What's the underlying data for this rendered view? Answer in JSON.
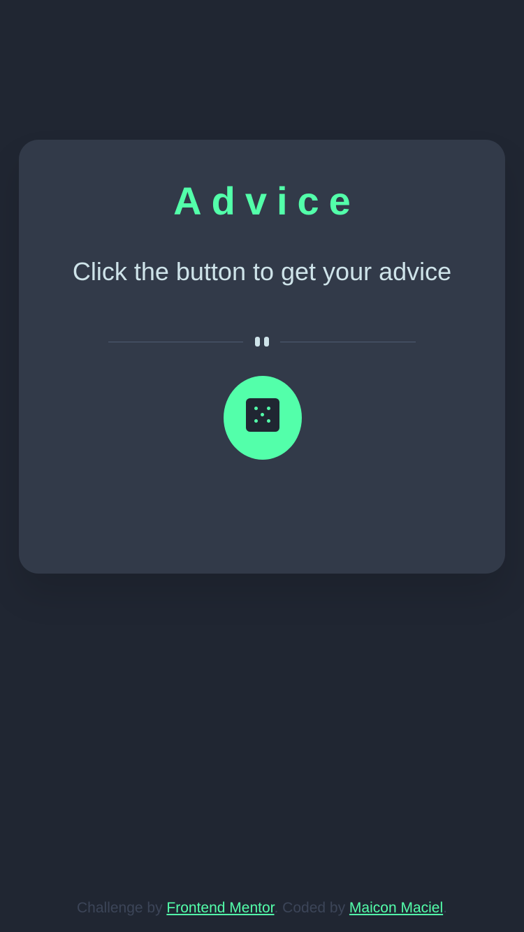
{
  "title": "Advice",
  "advice": "Click the button to get your advice",
  "footer": {
    "prefix": "Challenge by ",
    "link1": "Frontend Mentor",
    "middle": ". Coded by ",
    "link2": "Maicon Maciel",
    "suffix": "."
  },
  "colors": {
    "accent": "#53ffaa",
    "card": "#323a49",
    "bg": "#202632"
  }
}
